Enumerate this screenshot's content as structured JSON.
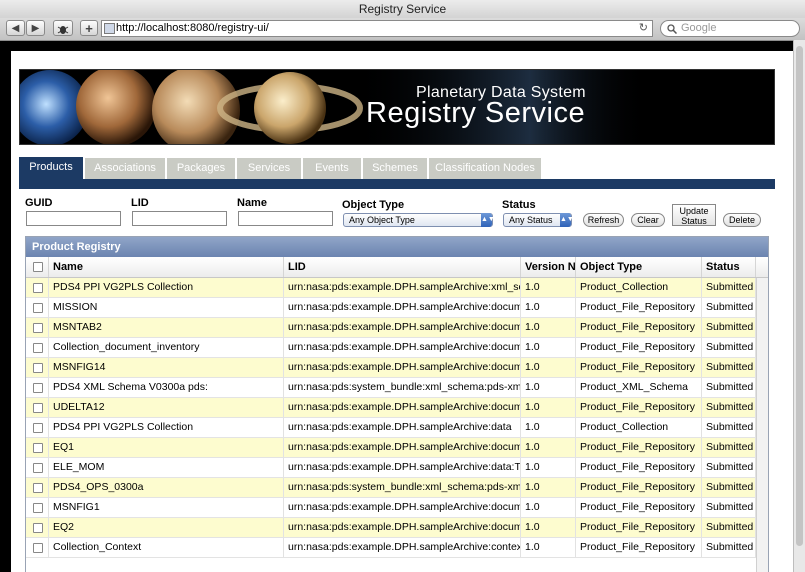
{
  "window": {
    "title": "Registry Service"
  },
  "browser": {
    "url": "http://localhost:8080/registry-ui/",
    "search_placeholder": "Google",
    "back_glyph": "◀",
    "forward_glyph": "▶",
    "add_glyph": "+",
    "reload_glyph": "↻"
  },
  "banner": {
    "subtitle": "Planetary Data System",
    "title": "Registry Service"
  },
  "tabs": [
    {
      "label": "Products",
      "active": true
    },
    {
      "label": "Associations"
    },
    {
      "label": "Packages"
    },
    {
      "label": "Services"
    },
    {
      "label": "Events"
    },
    {
      "label": "Schemes"
    },
    {
      "label": "Classification Nodes"
    }
  ],
  "filters": {
    "guid_label": "GUID",
    "lid_label": "LID",
    "name_label": "Name",
    "object_type_label": "Object Type",
    "object_type_value": "Any Object Type",
    "status_label": "Status",
    "status_value": "Any Status",
    "refresh_label": "Refresh",
    "clear_label": "Clear",
    "update_status_line1": "Update",
    "update_status_line2": "Status",
    "delete_label": "Delete"
  },
  "grid": {
    "title": "Product Registry",
    "columns": [
      "Name",
      "LID",
      "Version N",
      "Object Type",
      "Status"
    ],
    "rows": [
      [
        "PDS4 PPI VG2PLS Collection",
        "urn:nasa:pds:example.DPH.sampleArchive:xml_sche",
        "1.0",
        "Product_Collection",
        "Submitted"
      ],
      [
        "MISSION",
        "urn:nasa:pds:example.DPH.sampleArchive:documen",
        "1.0",
        "Product_File_Repository",
        "Submitted"
      ],
      [
        "MSNTAB2",
        "urn:nasa:pds:example.DPH.sampleArchive:documen",
        "1.0",
        "Product_File_Repository",
        "Submitted"
      ],
      [
        "Collection_document_inventory",
        "urn:nasa:pds:example.DPH.sampleArchive:documen",
        "1.0",
        "Product_File_Repository",
        "Submitted"
      ],
      [
        "MSNFIG14",
        "urn:nasa:pds:example.DPH.sampleArchive:documen",
        "1.0",
        "Product_File_Repository",
        "Submitted"
      ],
      [
        "PDS4 XML Schema V0300a pds:",
        "urn:nasa:pds:system_bundle:xml_schema:pds-xml_s",
        "1.0",
        "Product_XML_Schema",
        "Submitted"
      ],
      [
        "UDELTA12",
        "urn:nasa:pds:example.DPH.sampleArchive:documen",
        "1.0",
        "Product_File_Repository",
        "Submitted"
      ],
      [
        "PDS4 PPI VG2PLS Collection",
        "urn:nasa:pds:example.DPH.sampleArchive:data",
        "1.0",
        "Product_Collection",
        "Submitted"
      ],
      [
        "EQ1",
        "urn:nasa:pds:example.DPH.sampleArchive:documen",
        "1.0",
        "Product_File_Repository",
        "Submitted"
      ],
      [
        "ELE_MOM",
        "urn:nasa:pds:example.DPH.sampleArchive:data:Tabl",
        "1.0",
        "Product_File_Repository",
        "Submitted"
      ],
      [
        "PDS4_OPS_0300a",
        "urn:nasa:pds:system_bundle:xml_schema:pds-xml_s",
        "1.0",
        "Product_File_Repository",
        "Submitted"
      ],
      [
        "MSNFIG1",
        "urn:nasa:pds:example.DPH.sampleArchive:documen",
        "1.0",
        "Product_File_Repository",
        "Submitted"
      ],
      [
        "EQ2",
        "urn:nasa:pds:example.DPH.sampleArchive:documen",
        "1.0",
        "Product_File_Repository",
        "Submitted"
      ],
      [
        "Collection_Context",
        "urn:nasa:pds:example.DPH.sampleArchive:context:C",
        "1.0",
        "Product_File_Repository",
        "Submitted"
      ]
    ]
  }
}
